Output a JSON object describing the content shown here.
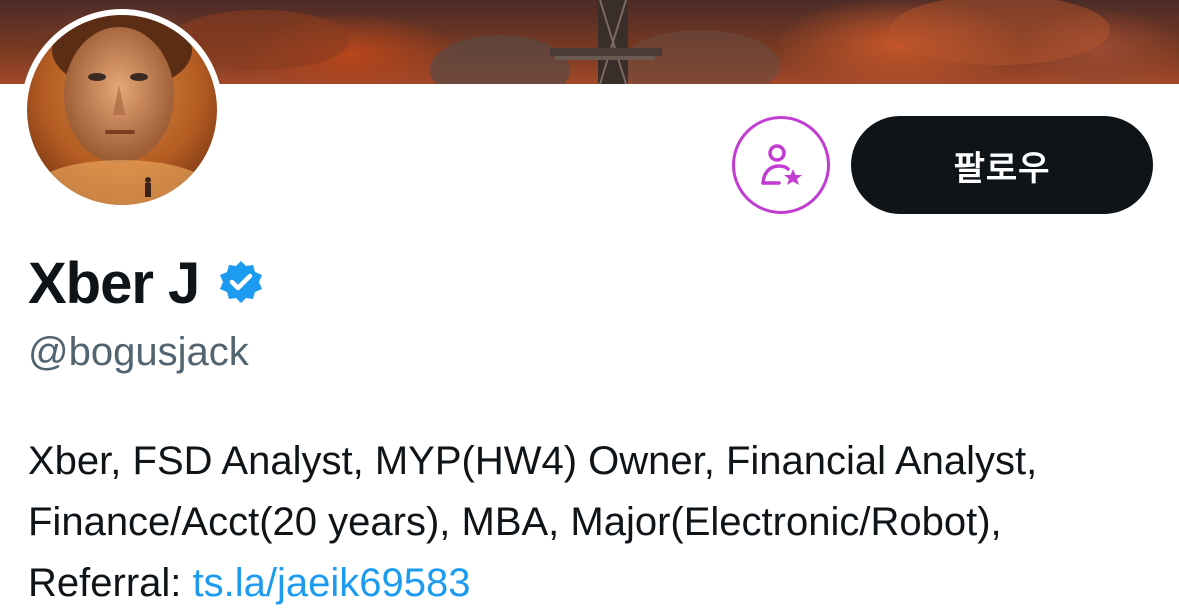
{
  "profile": {
    "display_name": "Xber J",
    "handle": "@bogusjack",
    "verified": true,
    "bio_lines": [
      "Xber, FSD Analyst, MYP(HW4) Owner, Financial Analyst,",
      "Finance/Acct(20 years), MBA, Major(Electronic/Robot),"
    ],
    "referral_label": "Referral: ",
    "referral_link": "ts.la/jaeik69583"
  },
  "actions": {
    "follow_label": "팔로우",
    "subscribe_icon": "person-star-icon"
  },
  "colors": {
    "follow_bg": "#0f1419",
    "subscribe_accent": "#c13cd0",
    "verified_badge": "#1d9bf0",
    "link": "#1d9bf0",
    "handle_text": "#536471"
  }
}
